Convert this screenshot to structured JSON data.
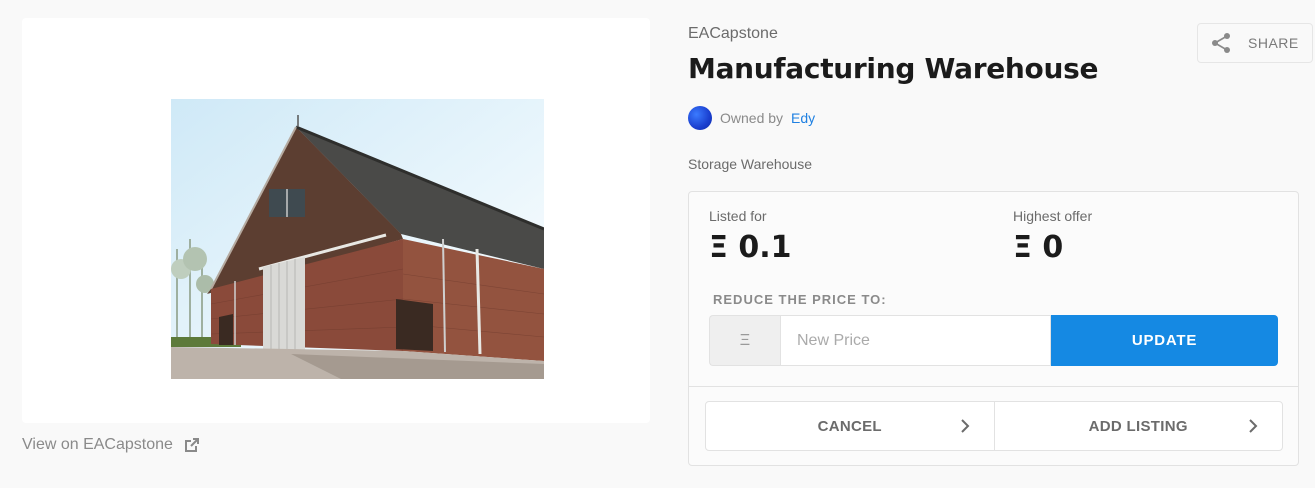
{
  "asset": {
    "collection": "EACapstone",
    "title": "Manufacturing Warehouse",
    "owner_prefix": "Owned by",
    "owner_name": "Edy",
    "description": "Storage Warehouse",
    "view_link": "View on EACapstone"
  },
  "share": {
    "label": "SHARE"
  },
  "pricing": {
    "listed_label": "Listed for",
    "listed_value": "Ξ 0.1",
    "offer_label": "Highest offer",
    "offer_value": "Ξ 0",
    "reduce_label": "REDUCE THE PRICE TO:",
    "currency_symbol": "Ξ",
    "price_placeholder": "New Price",
    "update_label": "UPDATE"
  },
  "actions": {
    "cancel_label": "CANCEL",
    "add_listing_label": "ADD LISTING"
  },
  "colors": {
    "accent": "#1589e3",
    "link": "#2081e2",
    "background": "#f9f9f9"
  },
  "icons": {
    "share": "share-icon",
    "external": "external-link-icon",
    "chevron": "chevron-right-icon"
  }
}
